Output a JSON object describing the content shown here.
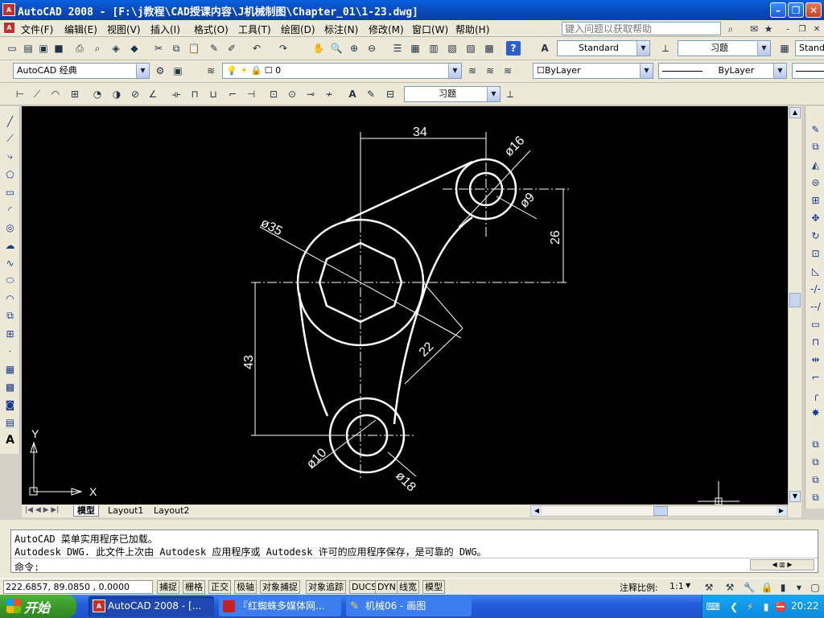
{
  "window": {
    "title": "AutoCAD 2008 - [F:\\j教程\\CAD授课内容\\J机械制图\\Chapter_01\\1-23.dwg]",
    "app_icon": "autocad-logo-icon"
  },
  "menubar": {
    "items": [
      {
        "label": "文件(F)"
      },
      {
        "label": "编辑(E)"
      },
      {
        "label": "视图(V)"
      },
      {
        "label": "插入(I)"
      },
      {
        "label": "格式(O)"
      },
      {
        "label": "工具(T)"
      },
      {
        "label": "绘图(D)"
      },
      {
        "label": "标注(N)"
      },
      {
        "label": "修改(M)"
      },
      {
        "label": "窗口(W)"
      },
      {
        "label": "帮助(H)"
      }
    ],
    "help_placeholder": "键入问题以获取帮助"
  },
  "toolbar": {
    "text_style": "Standard",
    "dim_style": "习题",
    "dim_style_right": "Stand",
    "workspace": "AutoCAD 经典",
    "layer": "0",
    "color": "ByLayer",
    "linetype": "ByLayer",
    "dim_style_row3": "习题"
  },
  "drawing": {
    "dim_34": "34",
    "dim_d16": "ø16",
    "dim_d9": "ø9",
    "dim_26": "26",
    "dim_d35": "ø35",
    "dim_22": "22",
    "dim_43": "43",
    "dim_d10": "ø10",
    "dim_d18": "ø18",
    "axis_x": "X",
    "axis_y": "Y"
  },
  "tabs": [
    {
      "label": "模型"
    },
    {
      "label": "Layout1"
    },
    {
      "label": "Layout2"
    }
  ],
  "command": {
    "line1": "AutoCAD 菜单实用程序已加载。",
    "line2": "Autodesk DWG.   此文件上次由 Autodesk 应用程序或 Autodesk 许可的应用程序保存，是可靠的 DWG。",
    "prompt": "命令:"
  },
  "status": {
    "coords": "222.6857, 89.0850 , 0.0000",
    "buttons": [
      "捕捉",
      "栅格",
      "正交",
      "极轴",
      "对象捕捉",
      "对象追踪",
      "DUCS",
      "DYN",
      "线宽",
      "模型"
    ],
    "scale_label": "注释比例:",
    "scale_value": "1:1"
  },
  "taskbar": {
    "start": "开始",
    "tasks": [
      {
        "label": "AutoCAD 2008 - [..."
      },
      {
        "label": "『红蜘蛛多媒体网..."
      },
      {
        "label": "机械06 - 画图"
      }
    ],
    "clock": "20:22"
  },
  "colors": {
    "canvas_bg": "#000000",
    "drawing_line": "#ffffff",
    "titlebar": "#0a5fdc",
    "taskbar": "#245edb",
    "start_button": "#3a9a2a"
  }
}
